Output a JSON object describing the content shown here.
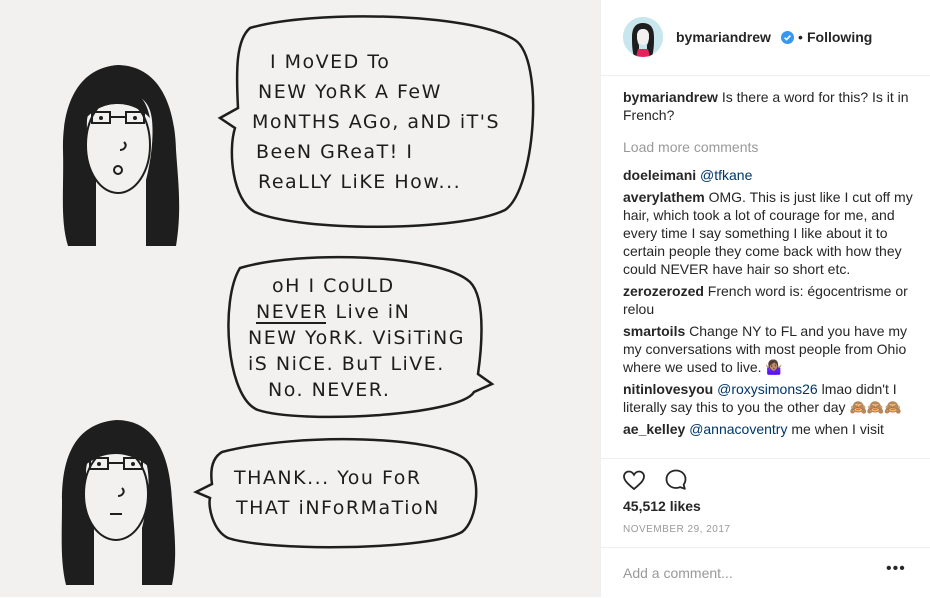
{
  "post": {
    "username": "bymariandrew",
    "follow_label": "Following",
    "separator": "•",
    "verified_icon": "verified-badge-icon"
  },
  "comic": {
    "bubble1": [
      "I MoVED To",
      "NEW YoRK A FeW",
      "MoNTHS AGo, aND iT'S",
      "BeeN GReaT! I",
      "ReaLLY LiKE How..."
    ],
    "bubble2": [
      "oH I CoULD",
      "NEVER Live iN",
      "NEW YoRK. ViSiTiNG",
      "iS NiCE. BuT LiVE.",
      "No. NEVER."
    ],
    "bubble3": [
      "THANK... You FoR",
      "THAT iNFoRMaTioN"
    ]
  },
  "caption": {
    "user": "bymariandrew",
    "text": " Is there a word for this? Is it in French?"
  },
  "load_more": "Load more comments",
  "comments": [
    {
      "user": "doeleimani",
      "mention": "@tfkane",
      "text": ""
    },
    {
      "user": "averylathem",
      "mention": "",
      "text": " OMG. This is just like I cut off my hair, which took a lot of courage for me, and every time I say something I like about it to certain people they come back with how they could NEVER have hair so short etc."
    },
    {
      "user": "zerozerozed",
      "mention": "",
      "text": " French word is: égocentrisme or relou"
    },
    {
      "user": "smartoils",
      "mention": "",
      "text": " Change NY to FL and you have my my conversations with most people from Ohio where we used to live. 🤷🏽‍♀️"
    },
    {
      "user": "nitinlovesyou",
      "mention": "@roxysimons26",
      "text": " lmao didn't I literally say this to you the other day 🙈🙈🙈"
    },
    {
      "user": "ae_kelley",
      "mention": "@annacoventry",
      "text": " me when I visit"
    }
  ],
  "likes": "45,512 likes",
  "date": "NOVEMBER 29, 2017",
  "add_comment": {
    "placeholder": "Add a comment..."
  },
  "more_label": "•••",
  "colors": {
    "link": "#003569",
    "verified": "#3897f0",
    "muted": "#999999"
  }
}
